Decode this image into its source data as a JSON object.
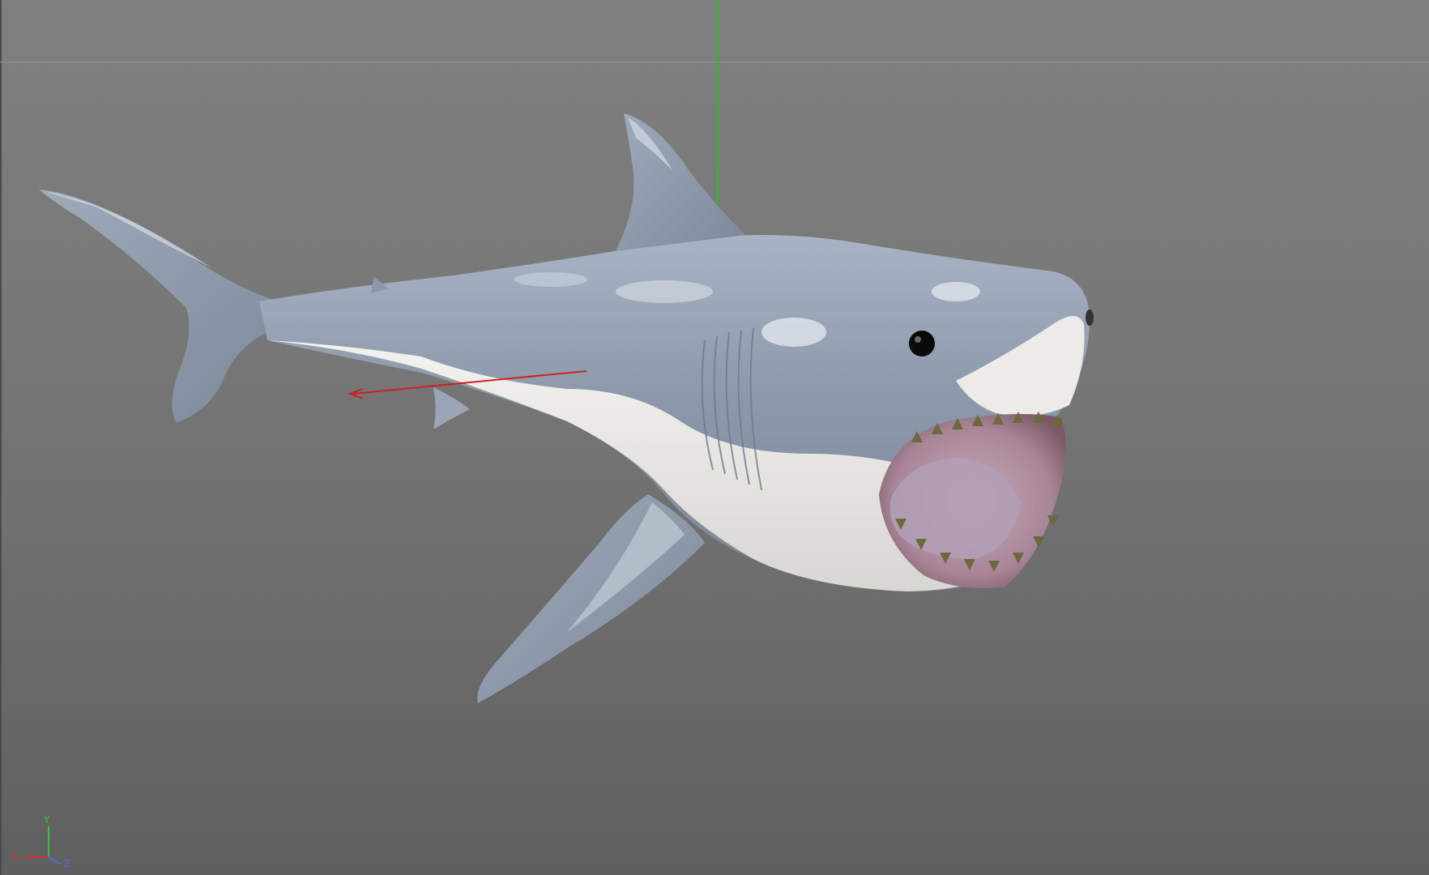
{
  "viewport": {
    "background_top": "#7f7f7f",
    "background_bottom": "#5f5f5f"
  },
  "gizmo": {
    "y_axis_color": "#22c022",
    "x_axis_color": "#d02020"
  },
  "axis_widget": {
    "y_label": "Y",
    "x_label": "X",
    "z_label": "Z",
    "y_color": "#3fbf3f",
    "x_color": "#d03030",
    "z_color": "#4a6fd8"
  },
  "model": {
    "icon": "shark-model",
    "body_color": "#8d9aab",
    "belly_color": "#ececea",
    "mouth_color": "#b8909a"
  }
}
